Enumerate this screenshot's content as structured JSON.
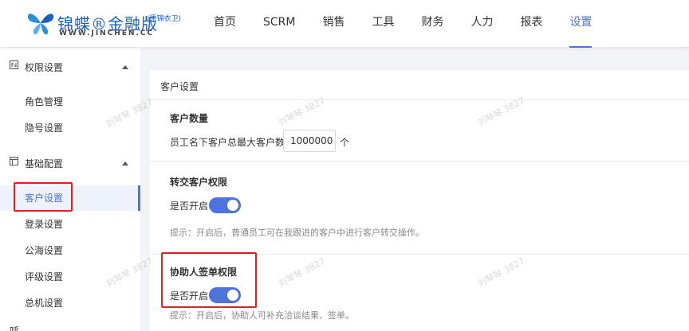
{
  "header": {
    "brand": "锦蝶®金融版",
    "edition": "(原锦衣卫)",
    "url": "WWW.JINCHEN.CC",
    "nav": [
      {
        "label": "首页",
        "active": false
      },
      {
        "label": "SCRM",
        "active": false
      },
      {
        "label": "销售",
        "active": false
      },
      {
        "label": "工具",
        "active": false
      },
      {
        "label": "财务",
        "active": false
      },
      {
        "label": "人力",
        "active": false
      },
      {
        "label": "报表",
        "active": false
      },
      {
        "label": "设置",
        "active": true
      }
    ]
  },
  "sidebar": {
    "groups": [
      {
        "label": "权限设置",
        "icon": "permission-icon",
        "items": [
          "角色管理",
          "隐号设置"
        ]
      },
      {
        "label": "基础配置",
        "icon": "config-icon",
        "items": [
          "客户设置",
          "登录设置",
          "公海设置",
          "评级设置",
          "总机设置"
        ]
      }
    ],
    "active_item": "客户设置",
    "partial_next": "呼"
  },
  "main": {
    "section_title": "客户设置",
    "customer_count": {
      "title": "客户数量",
      "label": "员工名下客户总最大客户数",
      "value": "1000000",
      "unit": "个"
    },
    "transfer": {
      "title": "转交客户权限",
      "switch_label": "是否开启",
      "enabled": true,
      "hint": "提示：开启后，普通员工可在我跟进的客户中进行客户转交操作。"
    },
    "assist": {
      "title": "协助人签单权限",
      "switch_label": "是否开启",
      "enabled": true,
      "hint": "提示：开启后，协助人可补充洽谈结果、签单。"
    }
  },
  "watermark": "刘琴琴 3827",
  "colors": {
    "accent": "#4f74d9",
    "highlight": "#e02020"
  }
}
